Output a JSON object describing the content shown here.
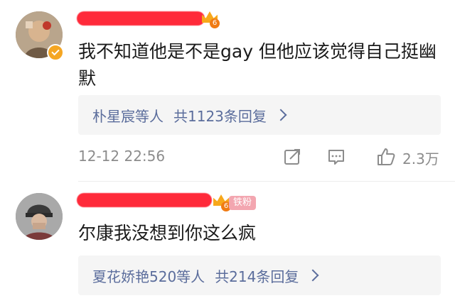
{
  "comments": [
    {
      "text": "我不知道他是不是gay 但他应该觉得自己挺幽默",
      "level": "6",
      "replies": {
        "names": "朴星宸等人",
        "count": "共1123条回复"
      },
      "timestamp": "12-12 22:56",
      "like_count": "2.3万"
    },
    {
      "text": "尔康我没想到你这么疯",
      "level": "6",
      "badge": "铁粉",
      "replies": {
        "names": "夏花娇艳520等人",
        "count": "共214条回复"
      }
    }
  ],
  "icons": {
    "share": "share-icon",
    "comment": "comment-icon",
    "like": "like-icon",
    "verified": "verified-badge-icon",
    "chevron": "chevron-right-icon"
  },
  "colors": {
    "redaction": "#ff2a3a",
    "link": "#5b6d9c",
    "meta": "#8c8c8c",
    "badge": "#f3a6b0",
    "level": "#f7a81b"
  }
}
